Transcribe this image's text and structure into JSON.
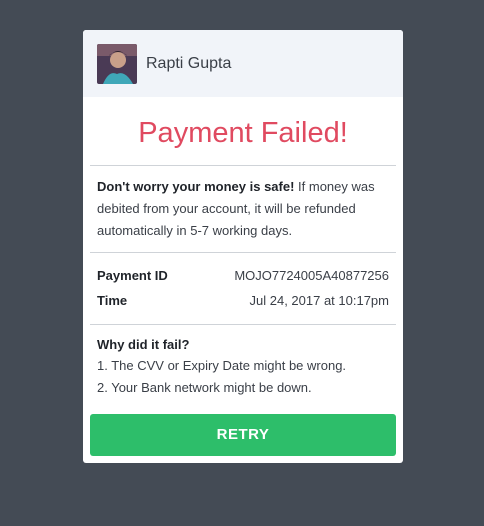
{
  "user": {
    "name": "Rapti Gupta"
  },
  "status": {
    "title": "Payment Failed!"
  },
  "notice": {
    "bold": "Don't worry your money is safe!",
    "text": " If money was debited from your account, it will be refunded automatically in 5-7 working days."
  },
  "details": {
    "payment_id_label": "Payment ID",
    "payment_id_value": "MOJO7724005A40877256",
    "time_label": "Time",
    "time_value": "Jul 24, 2017 at 10:17pm"
  },
  "reasons": {
    "title": "Why did it fail?",
    "items": [
      "1. The CVV or Expiry Date might be wrong.",
      "2. Your Bank network might be down."
    ]
  },
  "actions": {
    "retry_label": "RETRY"
  },
  "colors": {
    "background": "#444b55",
    "error": "#e04a60",
    "success": "#2dbe6a"
  }
}
